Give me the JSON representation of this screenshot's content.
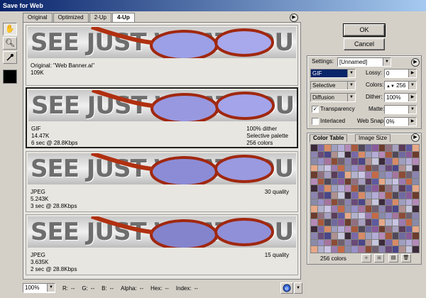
{
  "window": {
    "title": "Save for Web"
  },
  "tabs": [
    {
      "label": "Original"
    },
    {
      "label": "Optimized"
    },
    {
      "label": "2-Up"
    },
    {
      "label": "4-Up"
    }
  ],
  "tools": [
    {
      "icon": "hand-icon"
    },
    {
      "icon": "zoom-icon"
    },
    {
      "icon": "eyedropper-icon"
    }
  ],
  "eyedropper_color": "#000000",
  "banner_text": "SEE JUST WHAT YOU'RE MISSING",
  "panes": [
    {
      "left": [
        "Original: \"Web Banner.ai\"",
        "109K"
      ],
      "right": []
    },
    {
      "left": [
        "GIF",
        "14.47K",
        "6 sec @ 28.8Kbps"
      ],
      "right": [
        "100% dither",
        "Selective palette",
        "256 colors"
      ]
    },
    {
      "left": [
        "JPEG",
        "5.243K",
        "3 sec @ 28.8Kbps"
      ],
      "right": [
        "30 quality"
      ]
    },
    {
      "left": [
        "JPEG",
        "3.635K",
        "2 sec @ 28.8Kbps"
      ],
      "right": [
        "15 quality"
      ]
    }
  ],
  "status": {
    "zoom": "100%",
    "r_label": "R:",
    "r": "--",
    "g_label": "G:",
    "g": "--",
    "b_label": "B:",
    "b": "--",
    "alpha_label": "Alpha:",
    "alpha": "--",
    "hex_label": "Hex:",
    "hex": "--",
    "index_label": "Index:",
    "index": "--"
  },
  "buttons": {
    "ok": "OK",
    "cancel": "Cancel"
  },
  "settings": {
    "label": "Settings:",
    "preset": "[Unnamed]",
    "format": "GIF",
    "lossy_label": "Lossy:",
    "lossy": "0",
    "palette": "Selective",
    "colors_label": "Colors:",
    "colors": "256",
    "dither_algo": "Diffusion",
    "dither_label": "Dither:",
    "dither": "100%",
    "transparency_label": "Transparency",
    "transparency_checked": true,
    "matte_label": "Matte:",
    "matte": "",
    "interlaced_label": "Interlaced",
    "interlaced_checked": false,
    "websnap_label": "Web Snap:",
    "websnap": "0%"
  },
  "color_table": {
    "tab_color": "Color Table",
    "tab_size": "Image Size",
    "count_label": "256 colors"
  },
  "colors": {
    "background": "#d4d0c8",
    "titlebar": "#0a246a",
    "selection": "#0a246a"
  }
}
